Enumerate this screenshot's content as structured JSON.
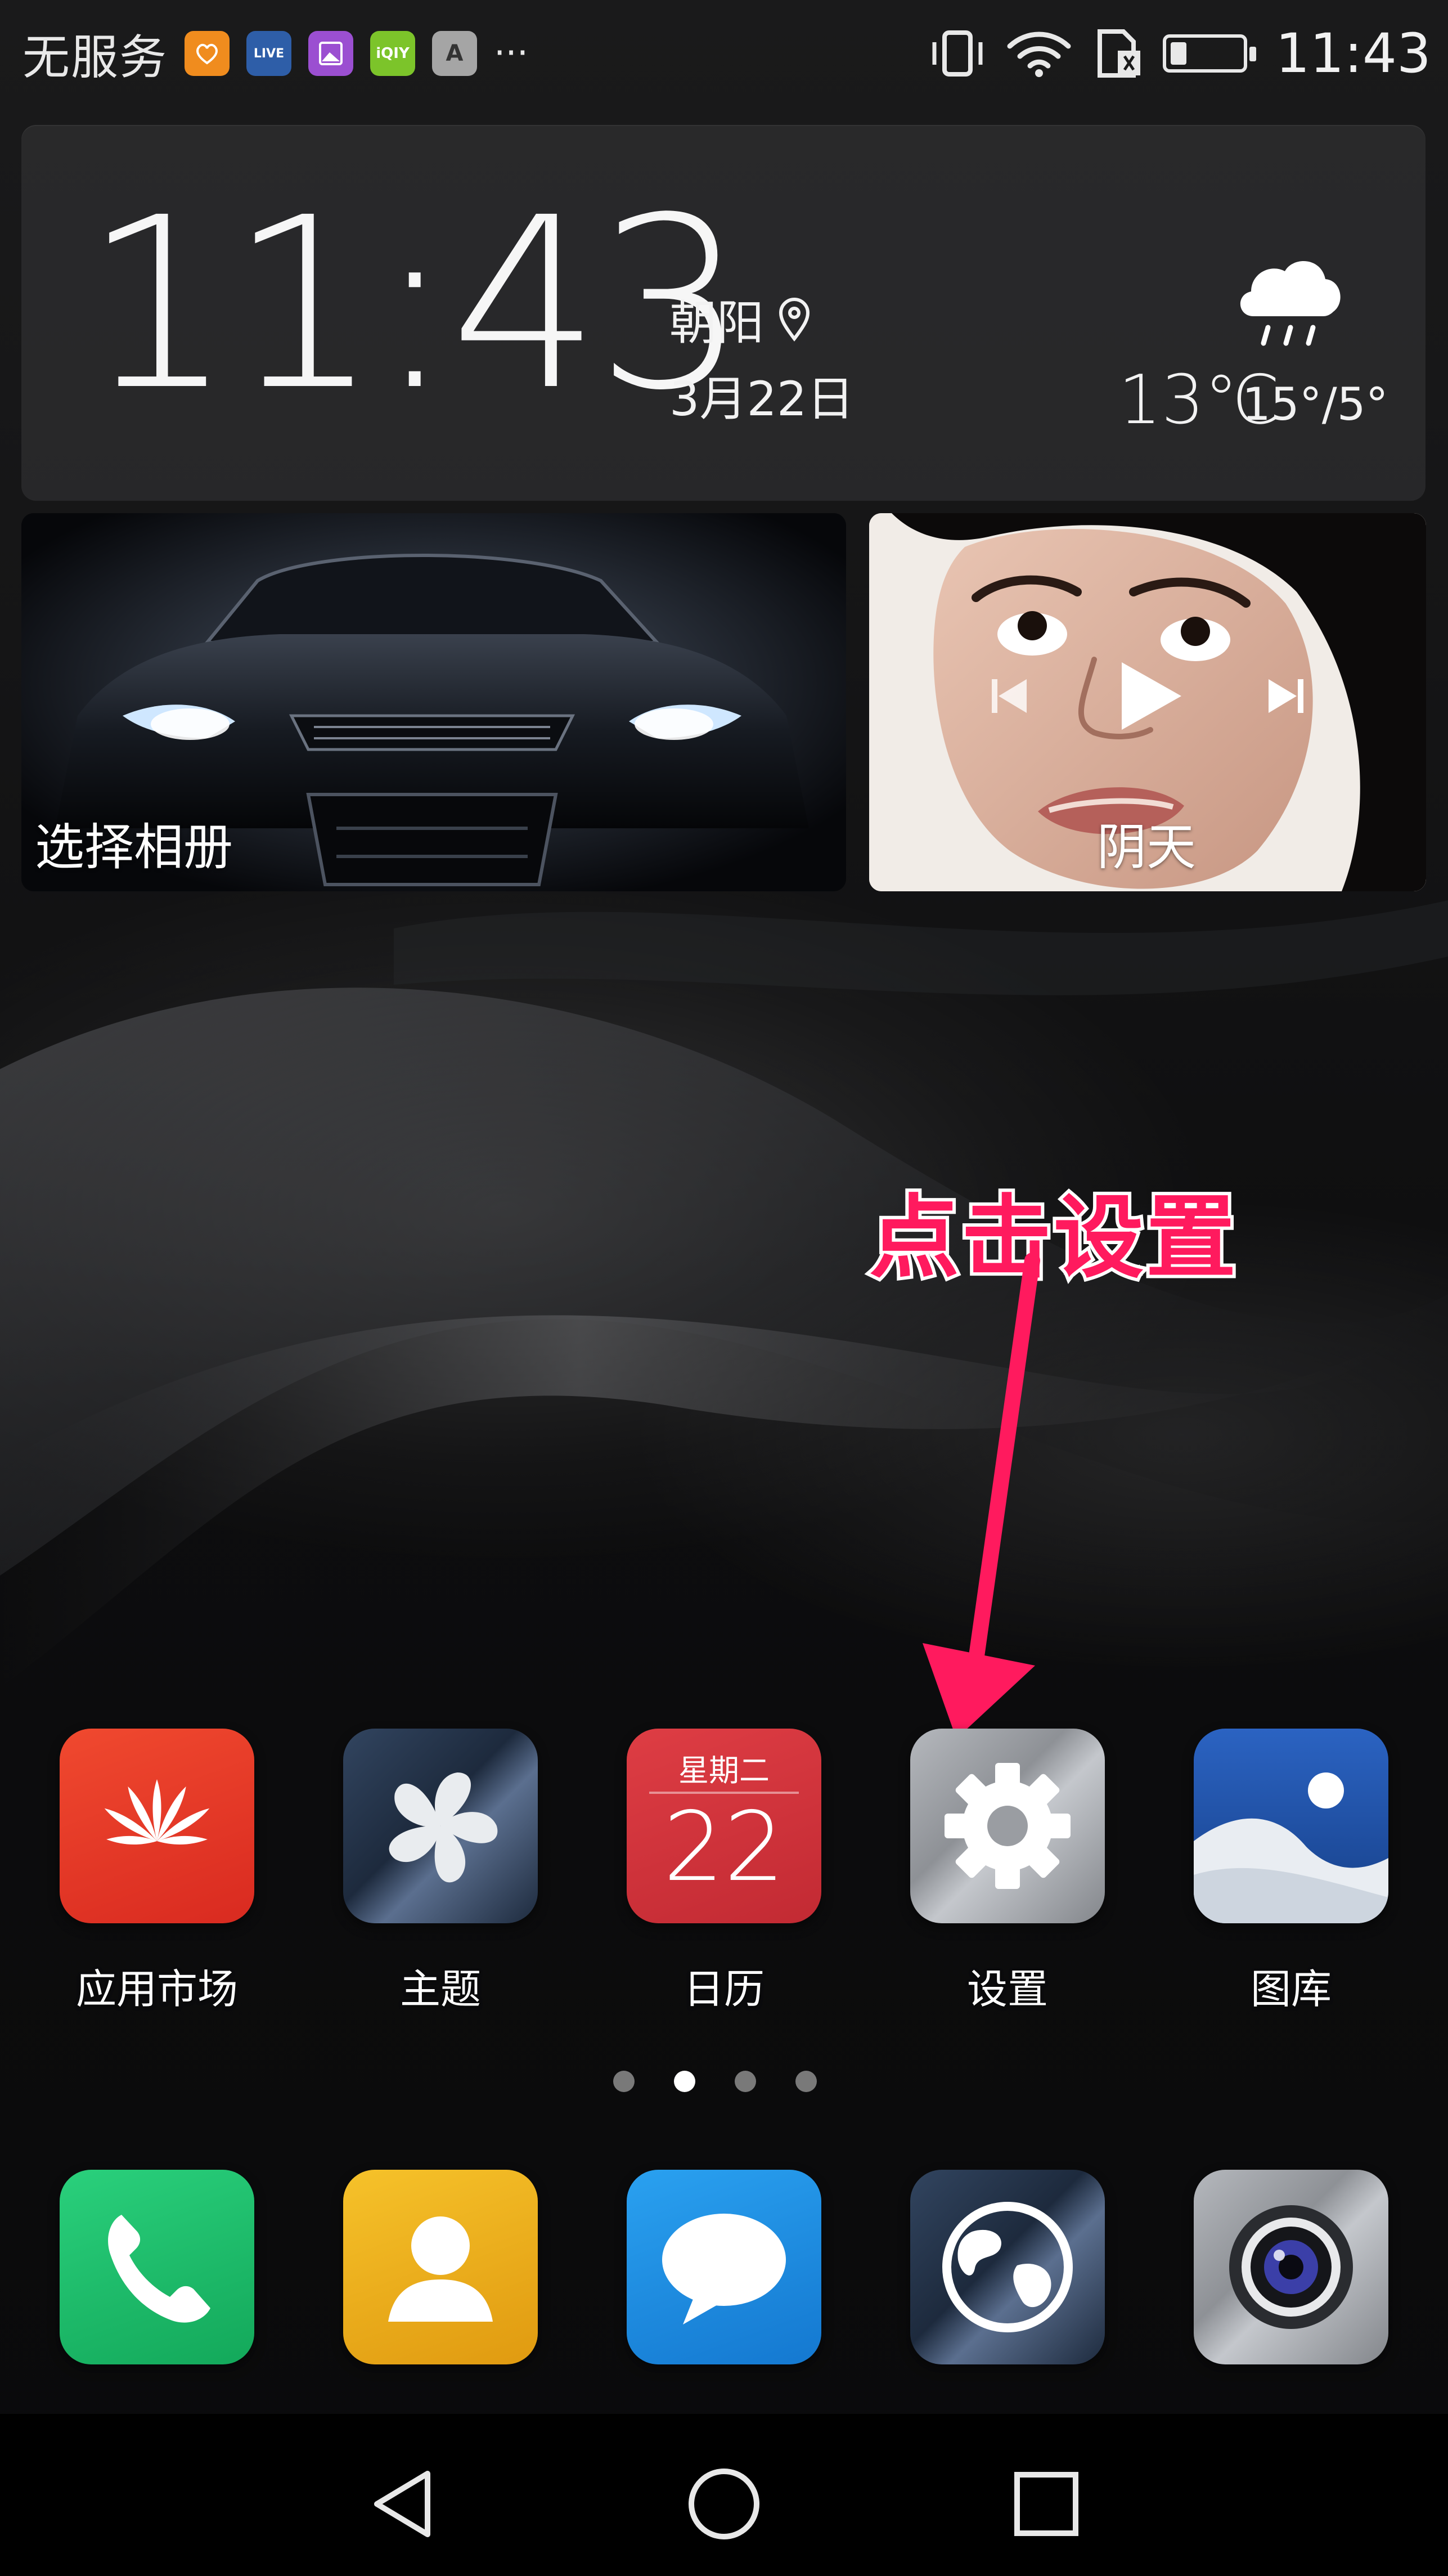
{
  "status_bar": {
    "carrier": "无服务",
    "time": "11:43",
    "notification_icons": [
      {
        "name": "health-app-icon",
        "label": "♡",
        "color": "#f08c1e"
      },
      {
        "name": "hd-video-app-icon",
        "label": "LIVE",
        "color": "#2e5ea8"
      },
      {
        "name": "gallery-app-icon",
        "label": "▨",
        "color": "#9b4fd1"
      },
      {
        "name": "iqiyi-app-icon",
        "label": "iQIY",
        "color": "#7cc42a"
      },
      {
        "name": "font-app-icon",
        "label": "A",
        "color": "#9a9a9a"
      }
    ],
    "more_label": "···",
    "battery_level": 0.2
  },
  "clock_widget": {
    "time": "11:43",
    "location": "朝阳",
    "date": "3月22日",
    "weather_icon": "rain-cloud-icon",
    "temperature": "13℃",
    "range": "15°/5°"
  },
  "album_widget": {
    "label": "选择相册"
  },
  "music_widget": {
    "title": "阴天"
  },
  "annotation": {
    "text": "点击设置",
    "color": "#ff1a5e"
  },
  "apps": [
    {
      "label": "应用市场",
      "icon": "huawei-appgallery-icon",
      "color": "#e8382b"
    },
    {
      "label": "主题",
      "icon": "themes-icon",
      "color": "#2a3a52"
    },
    {
      "label": "日历",
      "icon": "calendar-icon",
      "color": "#d2323b",
      "weekday": "星期二",
      "day": "22"
    },
    {
      "label": "设置",
      "icon": "settings-gear-icon",
      "color": "#9ea1a6"
    },
    {
      "label": "图库",
      "icon": "gallery-icon",
      "color": "#1f4f9e"
    }
  ],
  "page_indicator": {
    "count": 4,
    "active": 1
  },
  "dock": [
    {
      "name": "phone",
      "icon": "phone-icon",
      "color": "#1fbf6a"
    },
    {
      "name": "contacts",
      "icon": "contacts-icon",
      "color": "#f0b21a"
    },
    {
      "name": "messages",
      "icon": "messages-icon",
      "color": "#1a8fe6"
    },
    {
      "name": "browser",
      "icon": "browser-globe-icon",
      "color": "#2a3a52"
    },
    {
      "name": "camera",
      "icon": "camera-icon",
      "color": "#9ea1a6"
    }
  ],
  "nav_bar": {
    "back": "back-icon",
    "home": "home-icon",
    "recents": "recents-icon"
  }
}
